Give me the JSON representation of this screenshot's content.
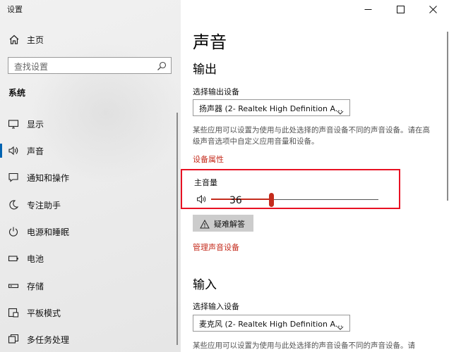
{
  "window": {
    "title": "设置",
    "controls": [
      "minimize-icon",
      "maximize-icon",
      "close-icon"
    ]
  },
  "sidebar": {
    "home_label": "主页",
    "search_placeholder": "查找设置",
    "section_title": "系统",
    "items": [
      {
        "label": "显示",
        "icon": "display-icon",
        "active": false
      },
      {
        "label": "声音",
        "icon": "speaker-icon",
        "active": true
      },
      {
        "label": "通知和操作",
        "icon": "notifications-icon",
        "active": false
      },
      {
        "label": "专注助手",
        "icon": "moon-icon",
        "active": false
      },
      {
        "label": "电源和睡眠",
        "icon": "power-icon",
        "active": false
      },
      {
        "label": "电池",
        "icon": "battery-icon",
        "active": false
      },
      {
        "label": "存储",
        "icon": "storage-icon",
        "active": false
      },
      {
        "label": "平板模式",
        "icon": "tablet-mode-icon",
        "active": false
      },
      {
        "label": "多任务处理",
        "icon": "multitasking-icon",
        "active": false
      }
    ]
  },
  "main": {
    "page_title": "声音",
    "output": {
      "heading": "输出",
      "device_label": "选择输出设备",
      "device_value": "扬声器 (2- Realtek High Definition A...",
      "description": "某些应用可以设置为使用与此处选择的声音设备不同的声音设备。请在高级声音选项中自定义应用音量和设备。",
      "properties_link": "设备属性",
      "volume_label": "主音量",
      "volume_value": "36",
      "volume_level": 0.36,
      "troubleshoot_label": "疑难解答",
      "manage_link": "管理声音设备"
    },
    "input": {
      "heading": "输入",
      "device_label": "选择输入设备",
      "device_value": "麦克风 (2- Realtek High Definition A...",
      "description": "某些应用可以设置为使用与此处选择的声音设备不同的声音设备。请"
    }
  },
  "colors": {
    "accent": "#c42b1c",
    "highlight_border": "#e81123",
    "active_indicator": "#0063b1"
  }
}
